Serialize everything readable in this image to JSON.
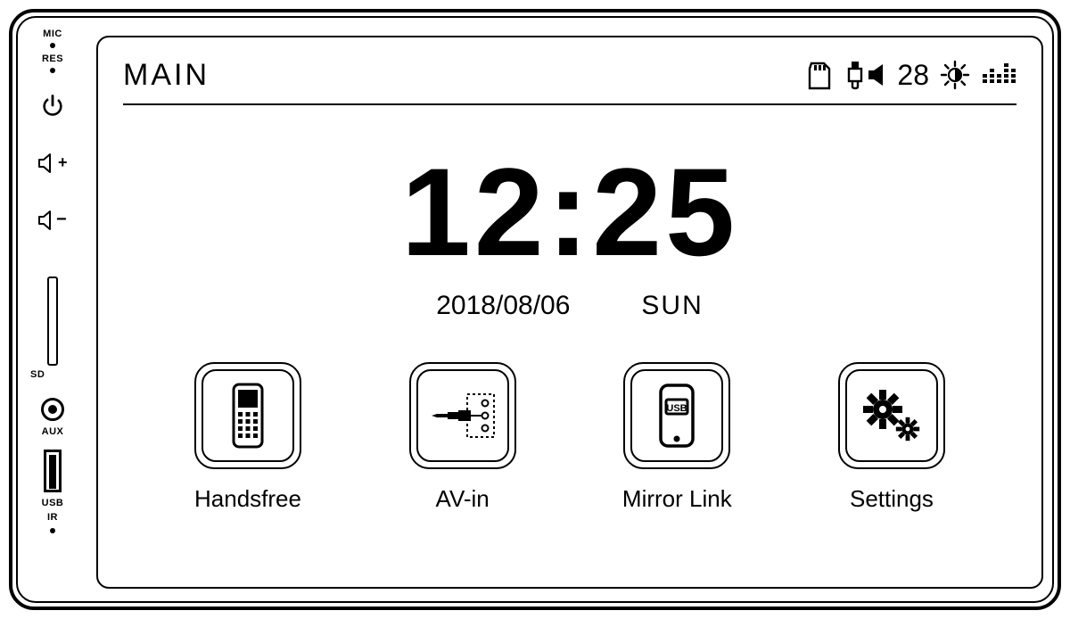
{
  "bezel": {
    "mic_label": "MIC",
    "res_label": "RES",
    "sd_label": "SD",
    "aux_label": "AUX",
    "usb_label": "USB",
    "ir_label": "IR",
    "vol_up": "+",
    "vol_down": "−"
  },
  "header": {
    "title": "MAIN",
    "volume": "28"
  },
  "clock": {
    "time": "12:25",
    "date": "2018/08/06",
    "day": "SUN"
  },
  "apps": [
    {
      "label": "Handsfree"
    },
    {
      "label": "AV-in"
    },
    {
      "label": "Mirror Link"
    },
    {
      "label": "Settings"
    }
  ]
}
